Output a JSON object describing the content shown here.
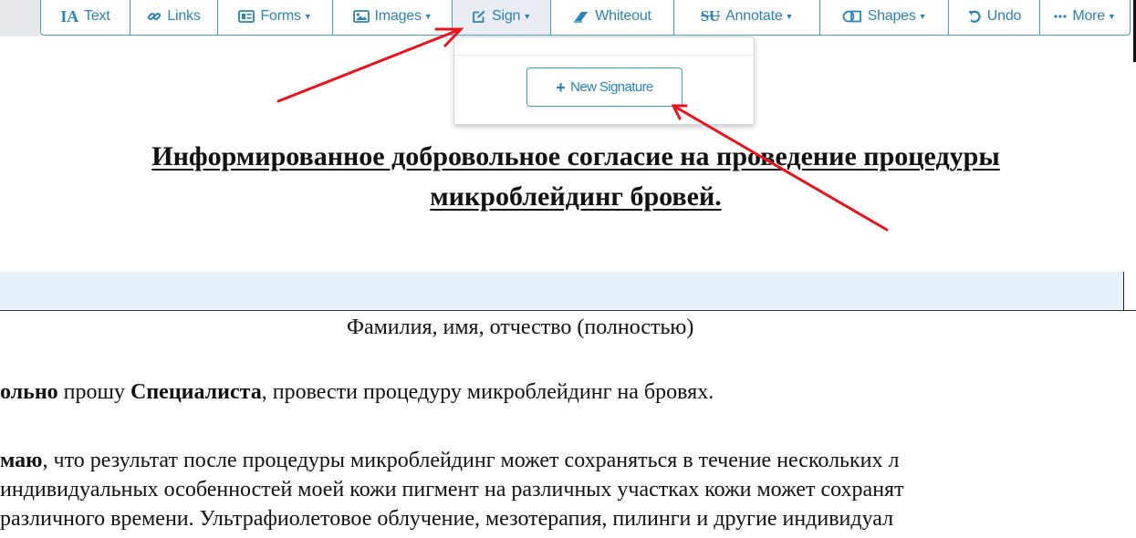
{
  "toolbar": {
    "items": [
      {
        "label": "Text",
        "icon": "text-cursor-icon",
        "has_caret": false
      },
      {
        "label": "Links",
        "icon": "link-icon",
        "has_caret": false
      },
      {
        "label": "Forms",
        "icon": "form-icon",
        "has_caret": true
      },
      {
        "label": "Images",
        "icon": "image-icon",
        "has_caret": true
      },
      {
        "label": "Sign",
        "icon": "edit-icon",
        "has_caret": true,
        "active": true
      },
      {
        "label": "Whiteout",
        "icon": "eraser-icon",
        "has_caret": false
      },
      {
        "label": "Annotate",
        "icon": "strikethrough-icon",
        "has_caret": true
      },
      {
        "label": "Shapes",
        "icon": "shapes-icon",
        "has_caret": true
      },
      {
        "label": "Undo",
        "icon": "undo-icon",
        "has_caret": false
      },
      {
        "label": "More",
        "icon": "ellipsis-icon",
        "has_caret": true
      }
    ],
    "text_icon_glyph": "IA",
    "annotate_icon_glyph": "SU",
    "accent_color": "#2a82b8"
  },
  "sign_dropdown": {
    "new_signature_label": "New Signature"
  },
  "document": {
    "title_line1": "Информированное добровольное согласие на проведение процедуры",
    "title_line2": "микроблейдинг бровей.",
    "name_caption": "Фамилия, имя, отчество (полностью)",
    "para1_bold1": "ольно",
    "para1_text1": " прошу ",
    "para1_bold2": "Специалиста",
    "para1_text2": ", провести процедуру микроблейдинг на бровях.",
    "para2_bold": "маю",
    "para2_line1": ", что результат после процедуры микроблейдинг может сохраняться в течение нескольких л",
    "para2_line2": "индивидуальных особенностей моей кожи пигмент на различных участках кожи может сохранят",
    "para2_line3": " различного времени. Ультрафиолетовое облучение, мезотерапия, пилинги и другие индивидуал"
  },
  "annotation_color": "#e8141b"
}
